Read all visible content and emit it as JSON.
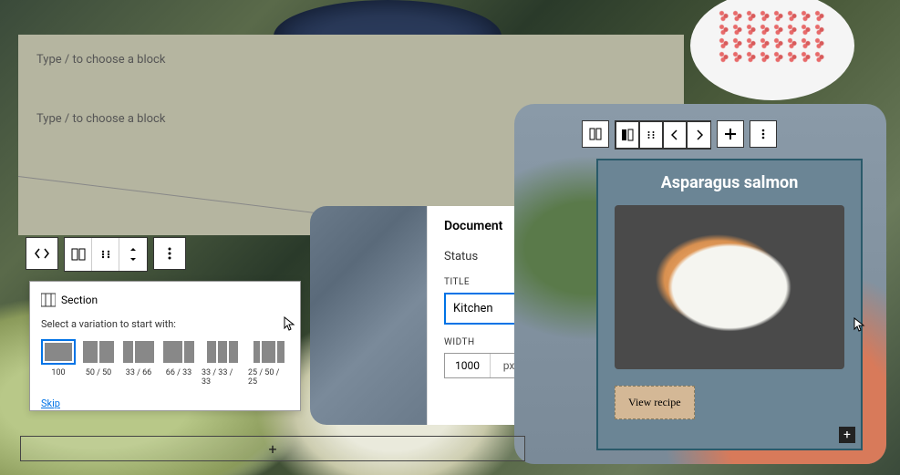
{
  "editor": {
    "placeholder1": "Type / to choose a block",
    "placeholder2": "Type / to choose a block"
  },
  "section_picker": {
    "heading": "Section",
    "subtitle": "Select a variation to start with:",
    "skip_label": "Skip",
    "variations": [
      {
        "label": "100",
        "cols": [
          1
        ]
      },
      {
        "label": "50 / 50",
        "cols": [
          1,
          1
        ]
      },
      {
        "label": "33 / 66",
        "cols": [
          1,
          2
        ]
      },
      {
        "label": "66 / 33",
        "cols": [
          2,
          1
        ]
      },
      {
        "label": "33 / 33 / 33",
        "cols": [
          1,
          1,
          1
        ]
      },
      {
        "label": "25 / 50 / 25",
        "cols": [
          1,
          2,
          1
        ]
      }
    ],
    "selected_index": 0
  },
  "document": {
    "heading": "Document",
    "status_label": "Status",
    "title_label": "TITLE",
    "title_value": "Kitchen",
    "width_label": "WIDTH",
    "width_value": "1000",
    "width_unit": "px"
  },
  "recipe": {
    "title": "Asparagus salmon",
    "button_label": "View recipe"
  },
  "icons": {
    "code": "code-icon",
    "columns": "columns-icon",
    "drag": "drag-icon",
    "arrows_v": "arrows-vertical-icon",
    "more": "more-icon",
    "chevron_up": "chevron-up-icon",
    "layout": "layout-icon",
    "move_l": "chevron-left-icon",
    "move_r": "chevron-right-icon",
    "plus": "plus-icon"
  }
}
